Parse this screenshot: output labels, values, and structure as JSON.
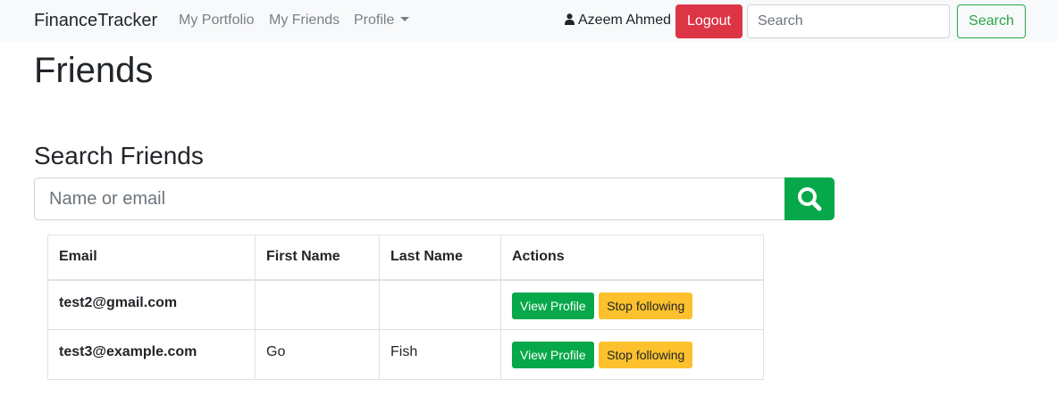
{
  "navbar": {
    "brand": "FinanceTracker",
    "links": [
      "My Portfolio",
      "My Friends",
      "Profile"
    ],
    "user_name": "Azeem Ahmed",
    "user_icon": "user-icon",
    "logout_label": "Logout",
    "search_placeholder": "Search",
    "search_button": "Search"
  },
  "page": {
    "title": "Friends",
    "search_heading": "Search Friends",
    "search_placeholder": "Name or email",
    "search_icon": "search-icon"
  },
  "table": {
    "headers": [
      "Email",
      "First Name",
      "Last Name",
      "Actions"
    ],
    "rows": [
      {
        "email": "test2@gmail.com",
        "first_name": "",
        "last_name": "",
        "view_label": "View Profile",
        "stop_label": "Stop following"
      },
      {
        "email": "test3@example.com",
        "first_name": "Go",
        "last_name": "Fish",
        "view_label": "View Profile",
        "stop_label": "Stop following"
      }
    ]
  },
  "colors": {
    "danger": "#dc3545",
    "success": "#06a84a",
    "warning": "#fcc12d",
    "navbar_bg": "#f8f9fa"
  }
}
